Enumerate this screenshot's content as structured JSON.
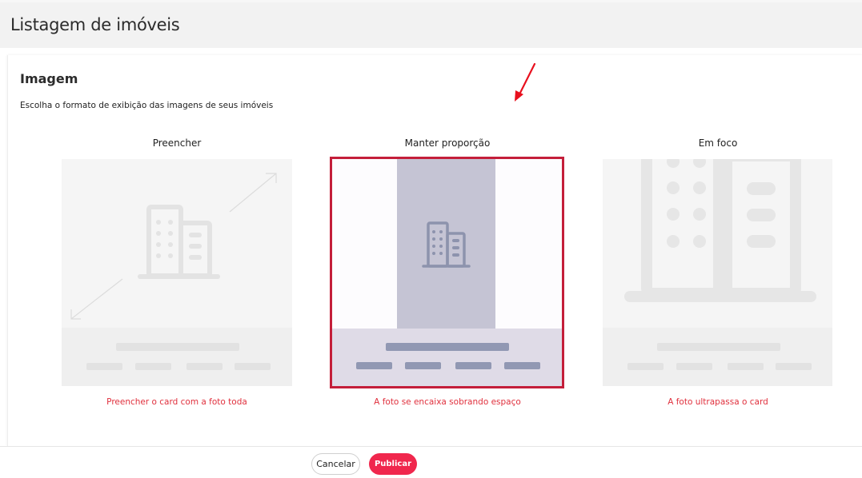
{
  "header": {
    "title": "Listagem de imóveis"
  },
  "section": {
    "title": "Imagem",
    "description": "Escolha o formato de exibição das imagens de seus imóveis"
  },
  "options": [
    {
      "label": "Preencher",
      "caption": "Preencher o card com a foto toda",
      "selected": false
    },
    {
      "label": "Manter proporção",
      "caption": "A foto se encaixa sobrando espaço",
      "selected": true
    },
    {
      "label": "Em foco",
      "caption": "A foto ultrapassa o card",
      "selected": false
    }
  ],
  "footer": {
    "cancel_label": "Cancelar",
    "publish_label": "Publicar"
  },
  "colors": {
    "accent": "#f0274d",
    "selected_border": "#c41e3a",
    "caption": "#e0303d",
    "annotation_arrow": "#e8101e"
  }
}
